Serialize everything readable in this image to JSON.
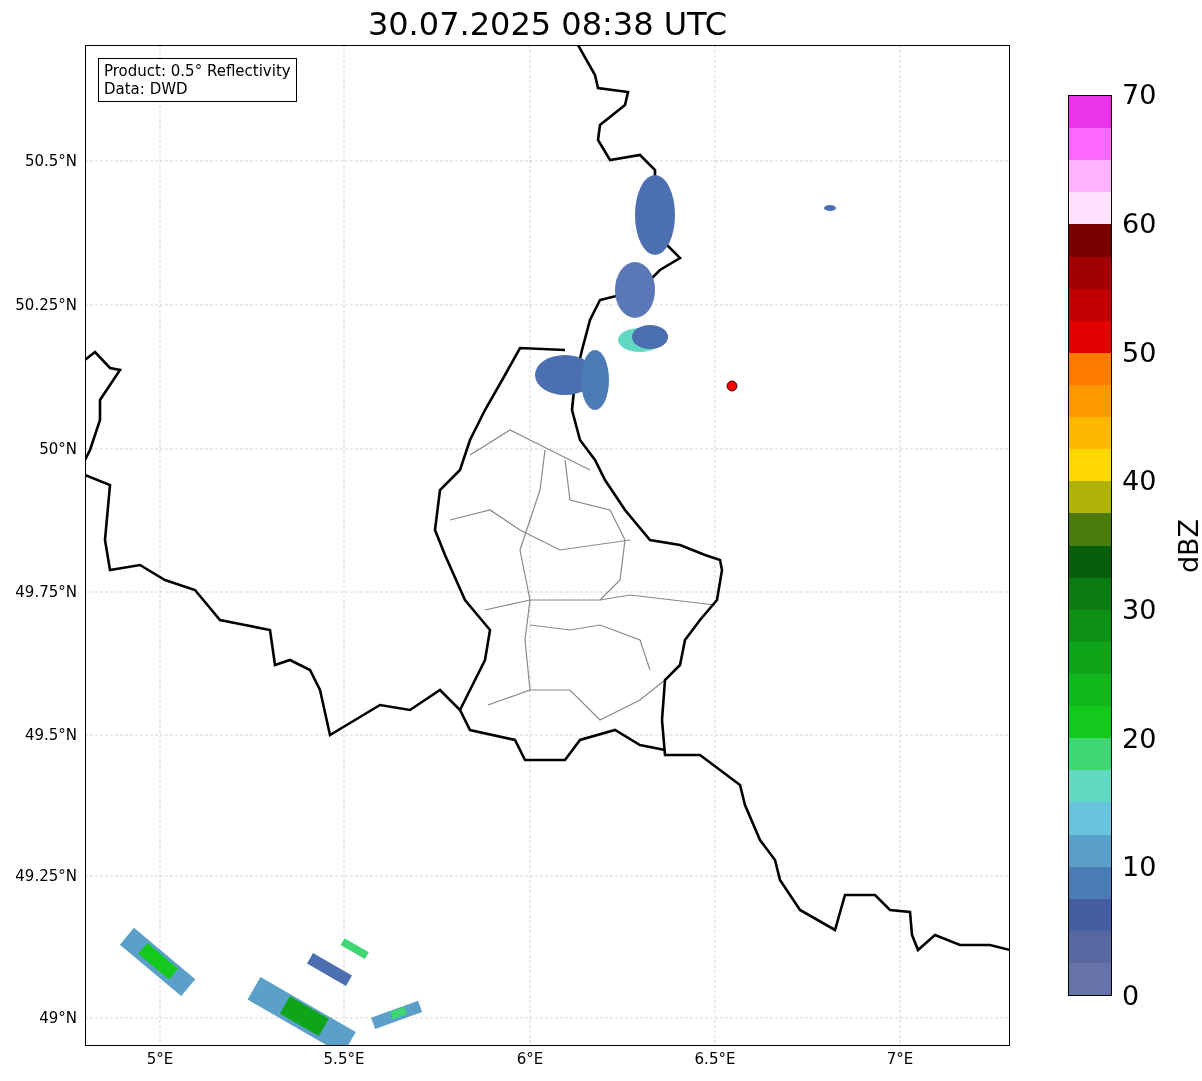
{
  "title": "30.07.2025 08:38 UTC",
  "info_box": [
    "Product: 0.5° Reflectivity",
    "Data: DWD"
  ],
  "y_ticks": [
    "50.5°N",
    "50.25°N",
    "50°N",
    "49.75°N",
    "49.5°N",
    "49.25°N",
    "49°N"
  ],
  "x_ticks": [
    "5°E",
    "5.5°E",
    "6°E",
    "6.5°E",
    "7°E"
  ],
  "colorbar": {
    "label": "dBZ",
    "ticks": [
      "70",
      "60",
      "50",
      "40",
      "30",
      "20",
      "10",
      "0"
    ],
    "bands": [
      {
        "color": "#ea33ea"
      },
      {
        "color": "#ff66ff"
      },
      {
        "color": "#ffb3ff"
      },
      {
        "color": "#ffe0ff"
      },
      {
        "color": "#7a0000"
      },
      {
        "color": "#a00000"
      },
      {
        "color": "#c00000"
      },
      {
        "color": "#e00000"
      },
      {
        "color": "#ff7b00"
      },
      {
        "color": "#ff9900"
      },
      {
        "color": "#ffb700"
      },
      {
        "color": "#ffd700"
      },
      {
        "color": "#b0b10a"
      },
      {
        "color": "#4a7b0c"
      },
      {
        "color": "#075e0b"
      },
      {
        "color": "#0b7b12"
      },
      {
        "color": "#0d9115"
      },
      {
        "color": "#0fa51a"
      },
      {
        "color": "#11b81b"
      },
      {
        "color": "#12c91c"
      },
      {
        "color": "#3fd674"
      },
      {
        "color": "#62d9c3"
      },
      {
        "color": "#68c4dc"
      },
      {
        "color": "#5ba0c8"
      },
      {
        "color": "#4b7bb5"
      },
      {
        "color": "#445ea1"
      },
      {
        "color": "#56689f"
      },
      {
        "color": "#6673a8"
      }
    ]
  }
}
